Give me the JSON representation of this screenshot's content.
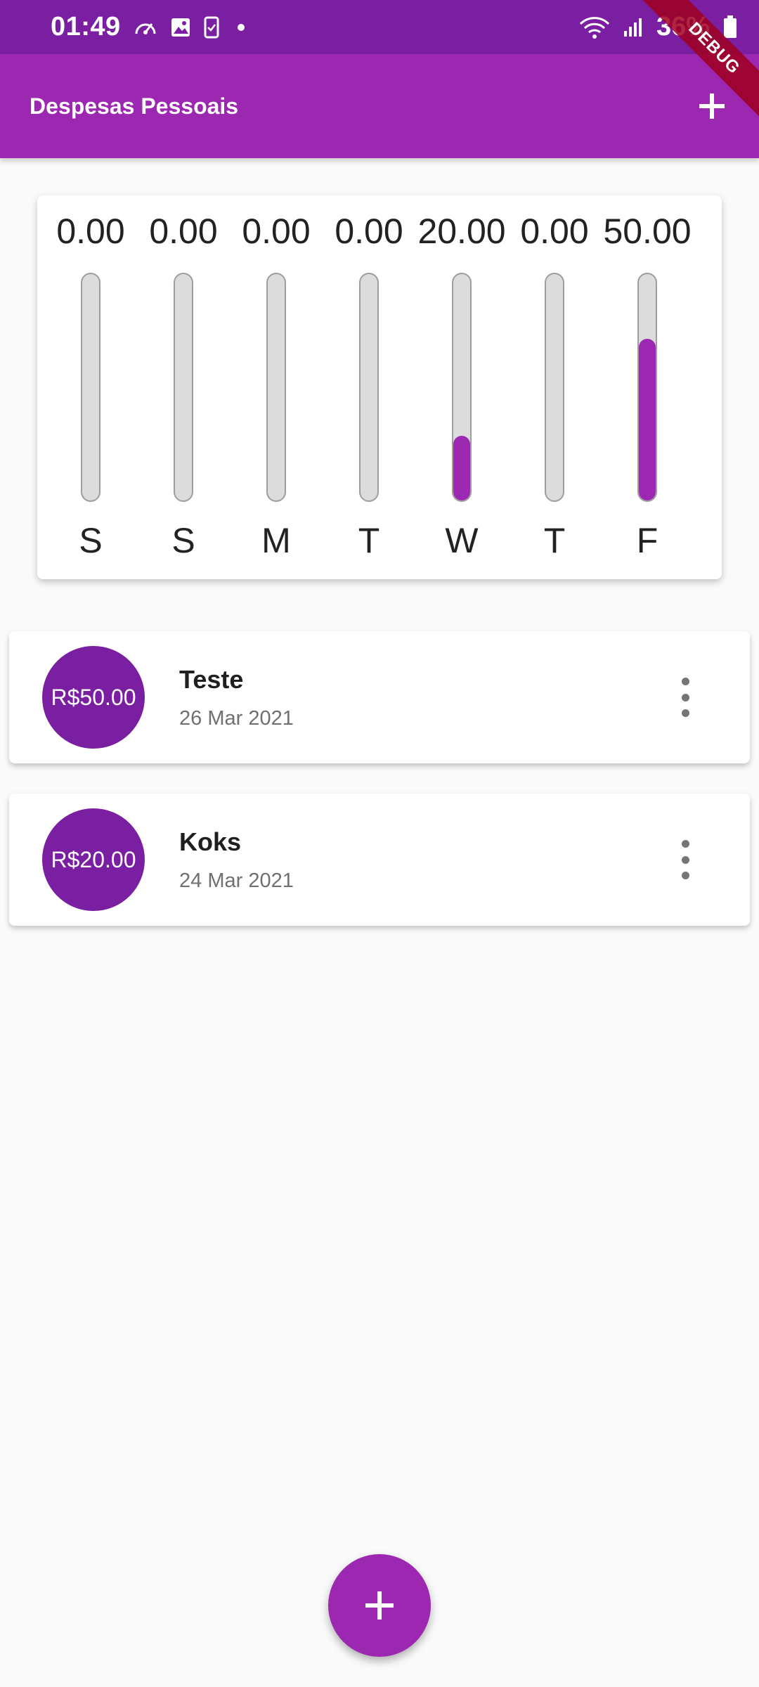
{
  "status_bar": {
    "time": "01:49",
    "battery": "36%",
    "icons": [
      "speedometer-icon",
      "image-icon",
      "phone-check-icon",
      "notification-dot-icon",
      "wifi-icon",
      "signal-icon",
      "battery-icon"
    ]
  },
  "app_bar": {
    "title": "Despesas Pessoais",
    "add_icon": "plus-icon",
    "color": "#9c27b0"
  },
  "debug_banner": "DEBUG",
  "chart_data": {
    "type": "bar",
    "categories": [
      "S",
      "S",
      "M",
      "T",
      "W",
      "T",
      "F"
    ],
    "values": [
      0.0,
      0.0,
      0.0,
      0.0,
      20.0,
      0.0,
      50.0
    ],
    "value_labels": [
      "0.00",
      "0.00",
      "0.00",
      "0.00",
      "20.00",
      "0.00",
      "50.00"
    ],
    "fill_fractions": [
      0,
      0,
      0,
      0,
      0.2857,
      0,
      0.7143
    ],
    "title": "",
    "xlabel": "",
    "ylabel": "",
    "fill_color": "#9c27b0",
    "track_color": "#dcdcdc"
  },
  "transactions": [
    {
      "amount": "R$50.00",
      "title": "Teste",
      "date": "26 Mar 2021"
    },
    {
      "amount": "R$20.00",
      "title": "Koks",
      "date": "24 Mar 2021"
    }
  ],
  "fab": {
    "icon": "plus-icon"
  }
}
